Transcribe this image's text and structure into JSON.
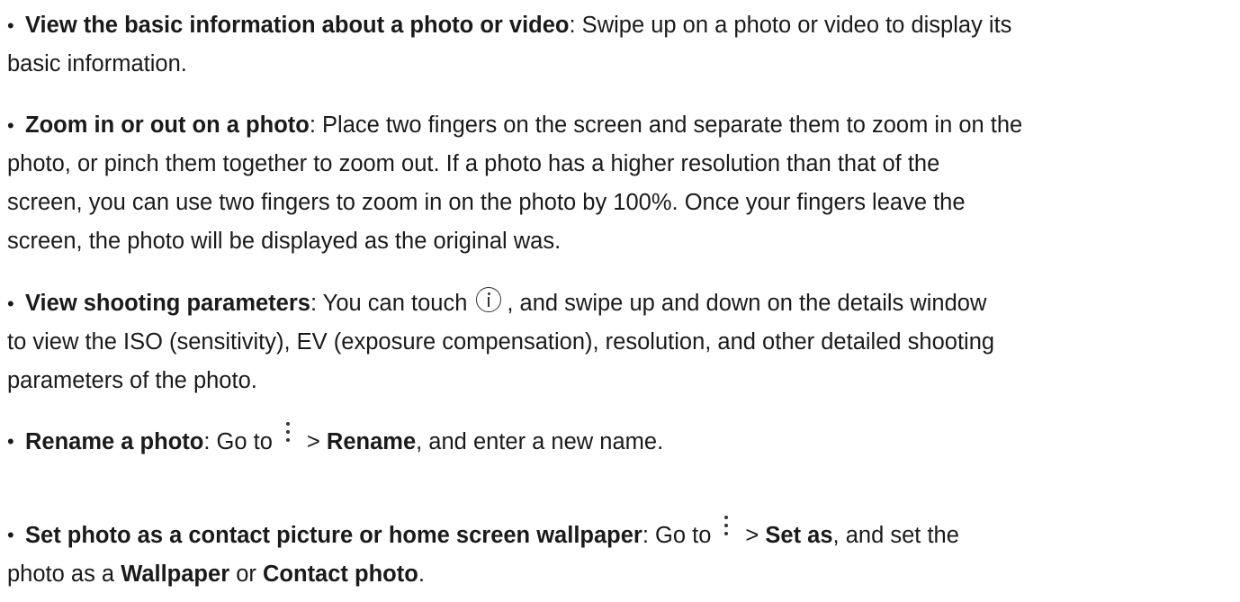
{
  "items": [
    {
      "title": "View the basic information about a photo or video",
      "line1": ": Swipe up on a photo or video to display its",
      "line2": "basic information."
    },
    {
      "title": "Zoom in or out on a photo",
      "line1": ": Place two fingers on the screen and separate them to zoom in on the",
      "line2": "photo, or pinch them together to zoom out. If a photo has a higher resolution than that of the",
      "line3": "screen, you can use two fingers to zoom in on the photo by 100%. Once your fingers leave the",
      "line4": "screen, the photo will be displayed as the original was."
    },
    {
      "title": "View shooting parameters",
      "line1a": ": You can touch",
      "line1b": ", and swipe up and down on the details window",
      "line2": "to view the ISO (sensitivity), EV (exposure compensation), resolution, and other detailed shooting",
      "line3": "parameters of the photo."
    },
    {
      "title": "Rename a photo",
      "pre": ": Go to",
      "sep": ">",
      "menu": "Rename",
      "post": ", and enter a new name."
    },
    {
      "title": "Set photo as a contact picture or home screen wallpaper",
      "pre": ": Go to",
      "sep": ">",
      "menu": "Set as",
      "post": ", and set the",
      "line2a": "photo as a",
      "opt1": "Wallpaper",
      "or": "or",
      "opt2": "Contact photo",
      "end": "."
    }
  ],
  "bullet": "•",
  "icons": {
    "info": "info-circle-icon",
    "more": "more-vertical-icon"
  }
}
